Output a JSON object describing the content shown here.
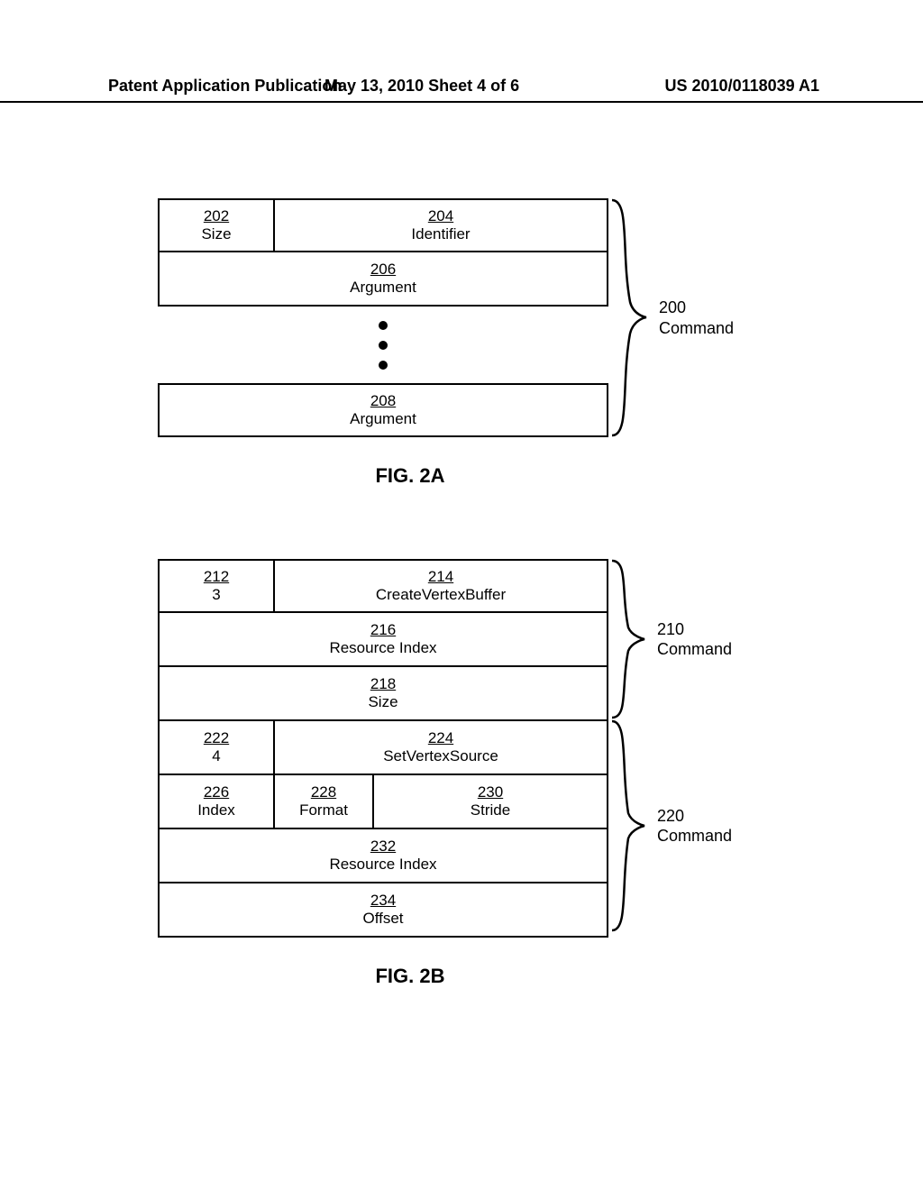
{
  "header": {
    "left": "Patent Application Publication",
    "mid": "May 13, 2010  Sheet 4 of 6",
    "right": "US 2010/0118039 A1"
  },
  "figA": {
    "caption": "FIG. 2A",
    "brace": {
      "ref": "200",
      "label": "Command"
    },
    "cells": {
      "size": {
        "ref": "202",
        "label": "Size"
      },
      "identifier": {
        "ref": "204",
        "label": "Identifier"
      },
      "argTop": {
        "ref": "206",
        "label": "Argument"
      },
      "argBot": {
        "ref": "208",
        "label": "Argument"
      }
    }
  },
  "figB": {
    "caption": "FIG. 2B",
    "brace1": {
      "ref": "210",
      "label": "Command"
    },
    "brace2": {
      "ref": "220",
      "label": "Command"
    },
    "cells": {
      "c212": {
        "ref": "212",
        "label": "3"
      },
      "c214": {
        "ref": "214",
        "label": "CreateVertexBuffer"
      },
      "c216": {
        "ref": "216",
        "label": "Resource Index"
      },
      "c218": {
        "ref": "218",
        "label": "Size"
      },
      "c222": {
        "ref": "222",
        "label": "4"
      },
      "c224": {
        "ref": "224",
        "label": "SetVertexSource"
      },
      "c226": {
        "ref": "226",
        "label": "Index"
      },
      "c228": {
        "ref": "228",
        "label": "Format"
      },
      "c230": {
        "ref": "230",
        "label": "Stride"
      },
      "c232": {
        "ref": "232",
        "label": "Resource Index"
      },
      "c234": {
        "ref": "234",
        "label": "Offset"
      }
    }
  }
}
